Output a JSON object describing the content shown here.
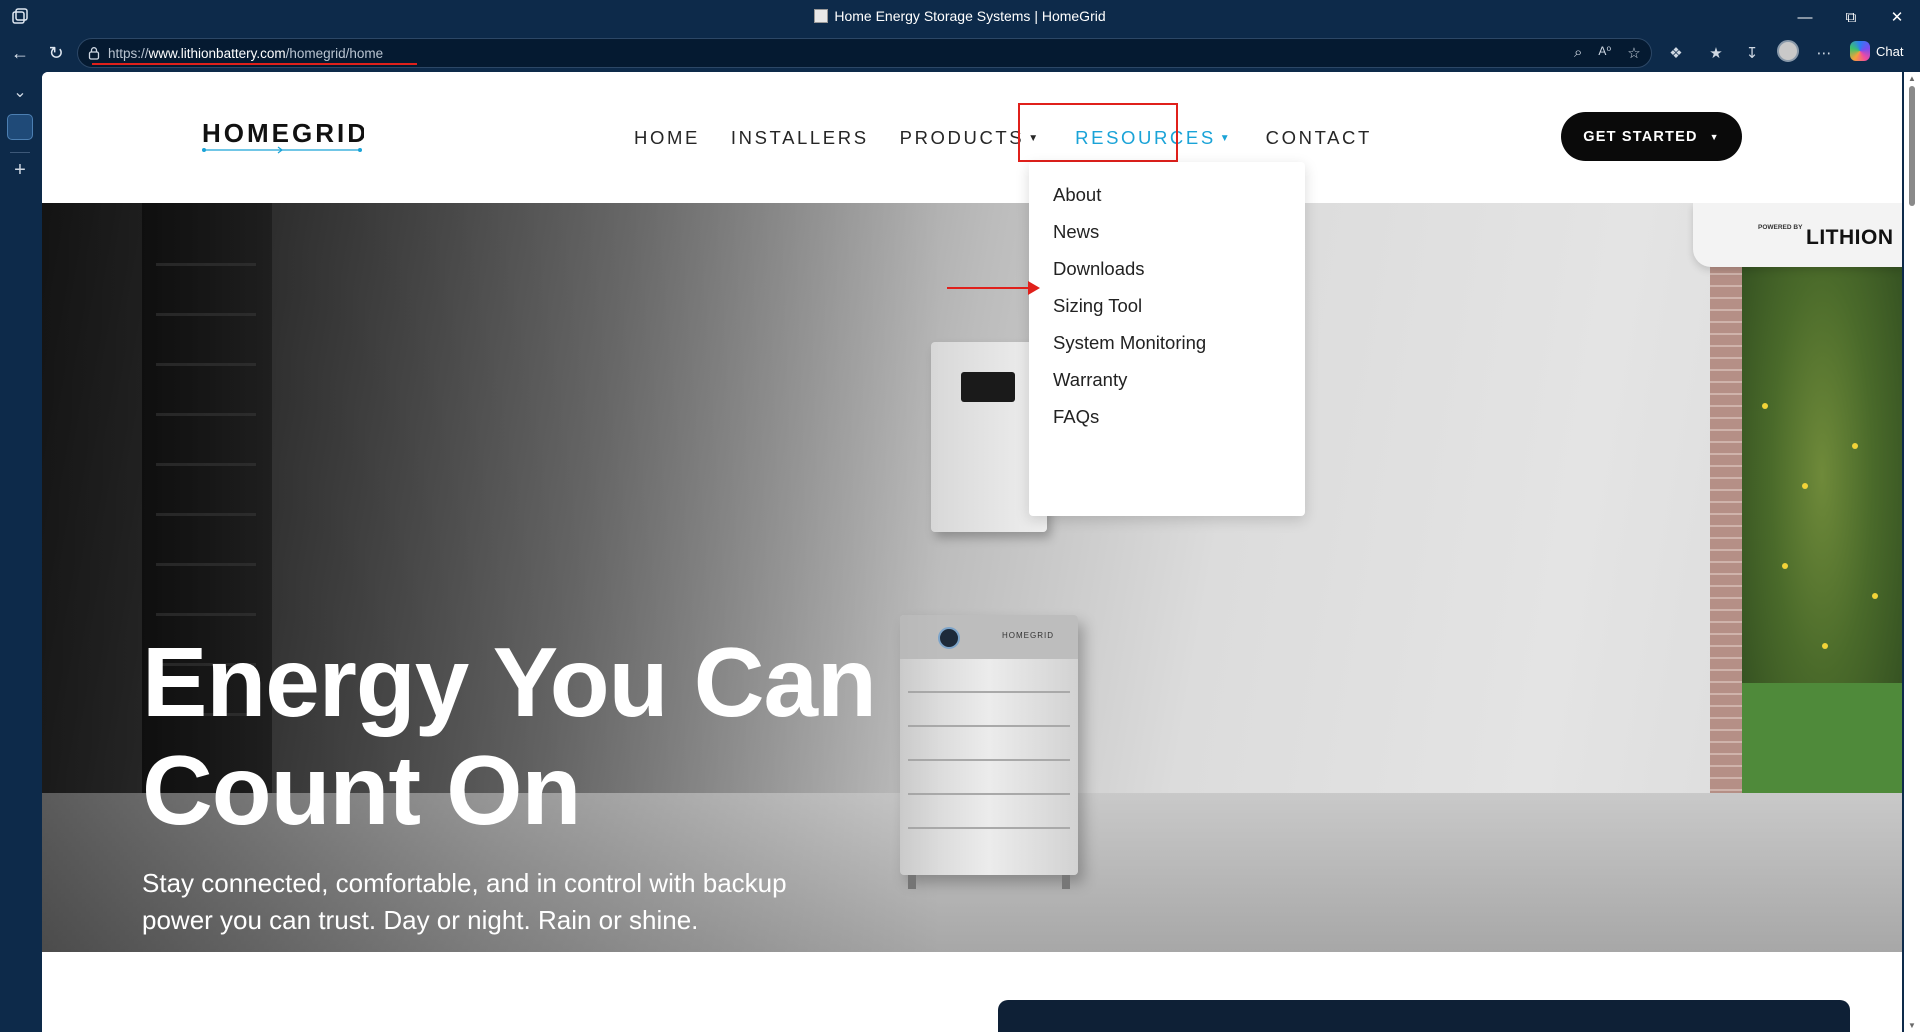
{
  "browser": {
    "window_title": "Home Energy Storage Systems | HomeGrid",
    "url_prefix": "https://",
    "url_domain": "www.lithionbattery.com",
    "url_path": "/homegrid/home",
    "chat_label": "Chat"
  },
  "site": {
    "logo_text": "HOMEGRID",
    "nav": [
      {
        "label": "HOME"
      },
      {
        "label": "INSTALLERS"
      },
      {
        "label": "PRODUCTS"
      },
      {
        "label": "RESOURCES"
      },
      {
        "label": "CONTACT"
      }
    ],
    "cta_label": "GET STARTED",
    "resources_menu": [
      "About",
      "News",
      "Downloads",
      "Sizing Tool",
      "System Monitoring",
      "Warranty",
      "FAQs"
    ]
  },
  "hero": {
    "headline": "Energy You Can Count On",
    "subheadline": "Stay connected, comfortable, and in control with backup power you can trust. Day or night. Rain or shine.",
    "badge_powered": "POWERED BY",
    "badge_brand": "LITHION",
    "battery_brand": "HOMEGRID"
  },
  "colors": {
    "accent": "#1aa3d7",
    "annotation": "#e0201b",
    "browser_chrome": "#0d2a4a",
    "cta": "#0a0a0a"
  }
}
